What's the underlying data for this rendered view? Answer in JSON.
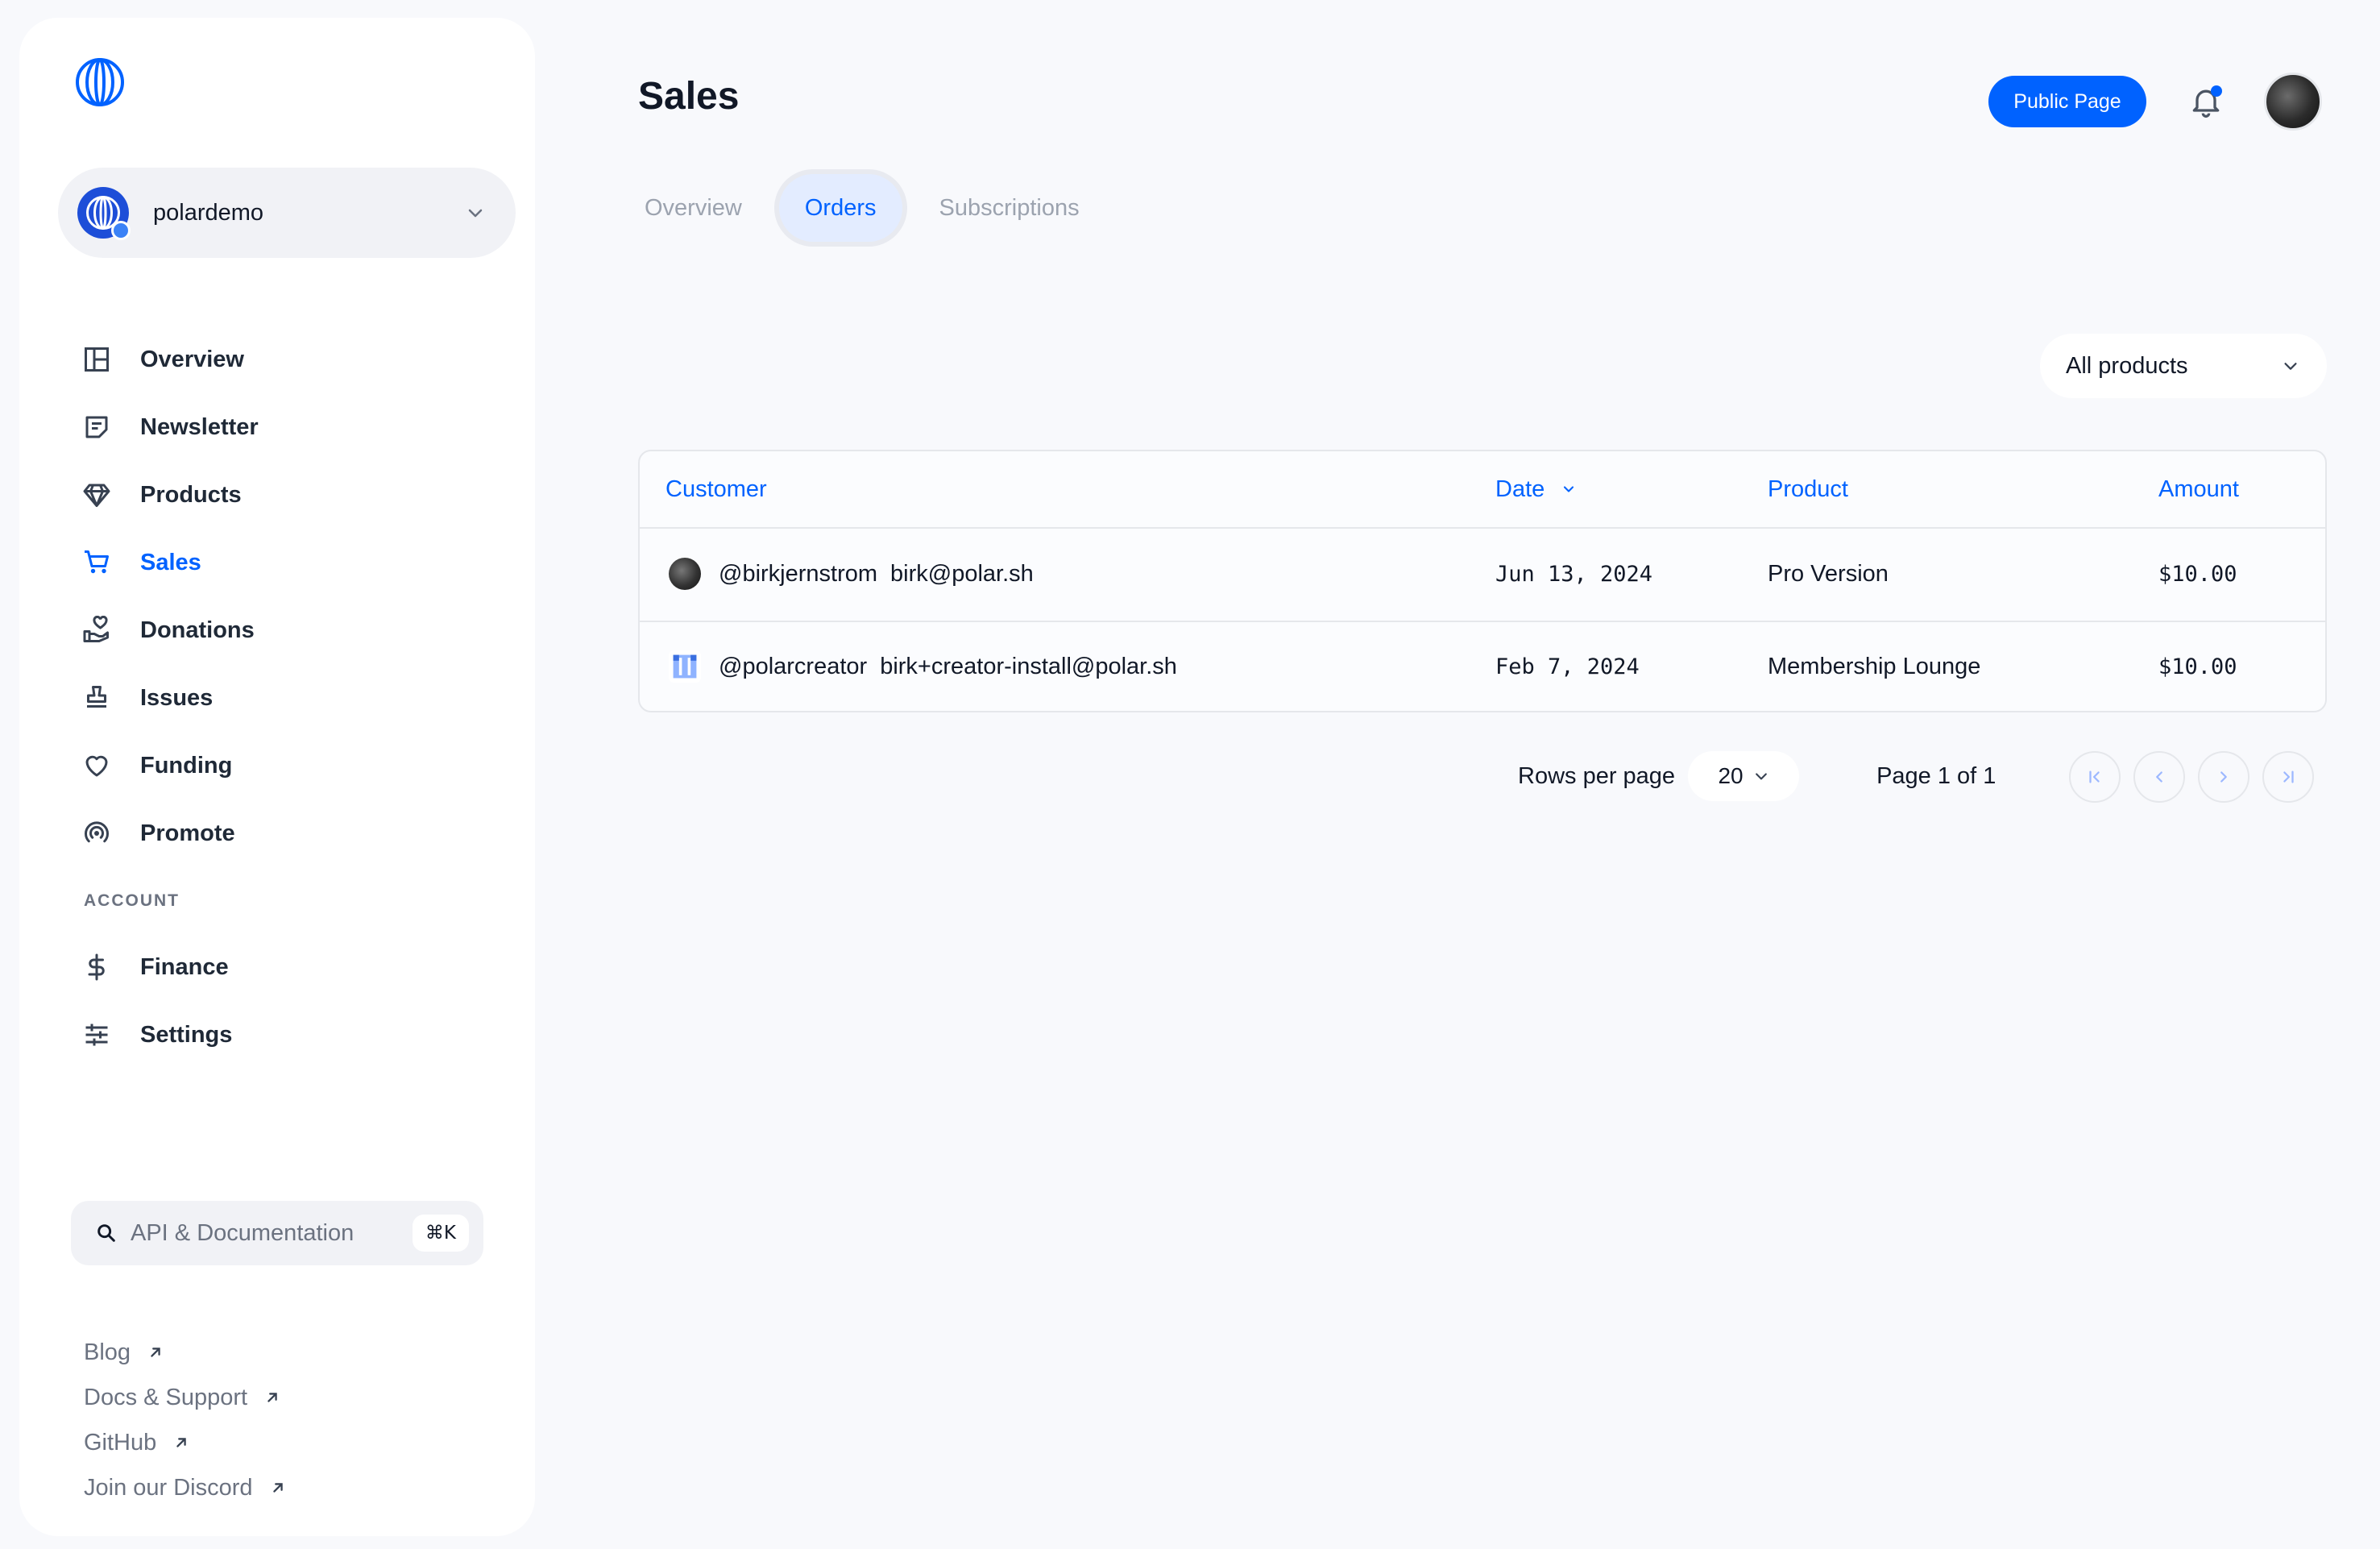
{
  "sidebar": {
    "org_name": "polardemo",
    "nav": [
      {
        "label": "Overview",
        "icon": "layout-icon",
        "active": false
      },
      {
        "label": "Newsletter",
        "icon": "newsletter-icon",
        "active": false
      },
      {
        "label": "Products",
        "icon": "diamond-icon",
        "active": false
      },
      {
        "label": "Sales",
        "icon": "cart-icon",
        "active": true
      },
      {
        "label": "Donations",
        "icon": "donation-hand-icon",
        "active": false
      },
      {
        "label": "Issues",
        "icon": "stamp-icon",
        "active": false
      },
      {
        "label": "Funding",
        "icon": "heart-icon",
        "active": false
      },
      {
        "label": "Promote",
        "icon": "broadcast-icon",
        "active": false
      }
    ],
    "account_label": "ACCOUNT",
    "account_nav": [
      {
        "label": "Finance",
        "icon": "dollar-icon"
      },
      {
        "label": "Settings",
        "icon": "sliders-icon"
      }
    ],
    "search": {
      "label": "API & Documentation",
      "shortcut": "⌘K"
    },
    "links": [
      {
        "label": "Blog"
      },
      {
        "label": "Docs & Support"
      },
      {
        "label": "GitHub"
      },
      {
        "label": "Join our Discord"
      }
    ]
  },
  "header": {
    "title": "Sales",
    "public_page_label": "Public Page"
  },
  "tabs": [
    {
      "label": "Overview",
      "active": false
    },
    {
      "label": "Orders",
      "active": true
    },
    {
      "label": "Subscriptions",
      "active": false
    }
  ],
  "filter": {
    "selected": "All products"
  },
  "table": {
    "columns": [
      "Customer",
      "Date",
      "Product",
      "Amount"
    ],
    "rows": [
      {
        "username": "@birkjernstrom",
        "email": "birk@polar.sh",
        "date": "Jun 13, 2024",
        "product": "Pro Version",
        "amount": "$10.00"
      },
      {
        "username": "@polarcreator",
        "email": "birk+creator-install@polar.sh",
        "date": "Feb 7, 2024",
        "product": "Membership Lounge",
        "amount": "$10.00"
      }
    ]
  },
  "pagination": {
    "rows_per_page_label": "Rows per page",
    "rows_per_page": "20",
    "page_info": "Page 1 of 1"
  },
  "colors": {
    "accent": "#0062ff",
    "background": "#f8f9fc"
  }
}
